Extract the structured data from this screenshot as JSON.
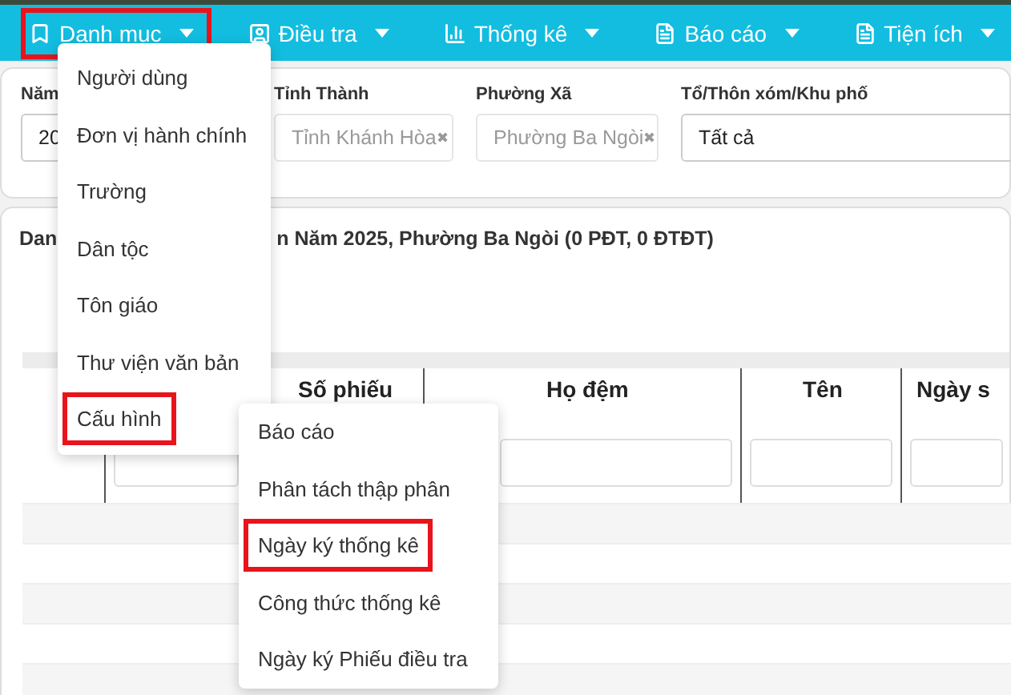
{
  "nav": [
    {
      "label": "Danh mục",
      "kind": "bookmark",
      "highlighted": true
    },
    {
      "label": "Điều tra",
      "kind": "contact",
      "highlighted": false
    },
    {
      "label": "Thống kê",
      "kind": "chart",
      "highlighted": false
    },
    {
      "label": "Báo cáo",
      "kind": "file",
      "highlighted": false
    },
    {
      "label": "Tiện ích",
      "kind": "file",
      "highlighted": false
    }
  ],
  "filters": [
    {
      "label": "Năm",
      "value": "20",
      "disabled": false
    },
    {
      "label": "Tỉnh Thành",
      "value": "Tỉnh Khánh Hòa",
      "disabled": true,
      "clear": "✖"
    },
    {
      "label": "Phường Xã",
      "value": "Phường Ba Ngòi",
      "disabled": true,
      "clear": "✖"
    },
    {
      "label": "Tổ/Thôn xóm/Khu phố",
      "value": "Tất cả",
      "disabled": false
    }
  ],
  "list_title": [
    "Dan",
    "n Năm 2025, Phường Ba Ngòi (0 PĐT, 0 ĐTĐT)"
  ],
  "table": {
    "columns": [
      {
        "label": "Số phiếu"
      },
      {
        "label": "Họ đệm"
      },
      {
        "label": "Tên"
      },
      {
        "label": "Ngày s"
      }
    ]
  },
  "menu": {
    "items": [
      {
        "label": "Người dùng",
        "highlighted": false
      },
      {
        "label": "Đơn vị hành chính",
        "highlighted": false
      },
      {
        "label": "Trường",
        "highlighted": false
      },
      {
        "label": "Dân tộc",
        "highlighted": false
      },
      {
        "label": "Tôn giáo",
        "highlighted": false
      },
      {
        "label": "Thư viện văn bản",
        "highlighted": false
      },
      {
        "label": "Cấu hình",
        "highlighted": true
      }
    ]
  },
  "submenu": {
    "items": [
      {
        "label": "Báo cáo",
        "highlighted": false
      },
      {
        "label": "Phân tách thập phân",
        "highlighted": false
      },
      {
        "label": "Ngày ký thống kê",
        "highlighted": true
      },
      {
        "label": "Công thức thống kê",
        "highlighted": false
      },
      {
        "label": "Ngày ký Phiếu điều tra",
        "highlighted": false
      }
    ]
  }
}
